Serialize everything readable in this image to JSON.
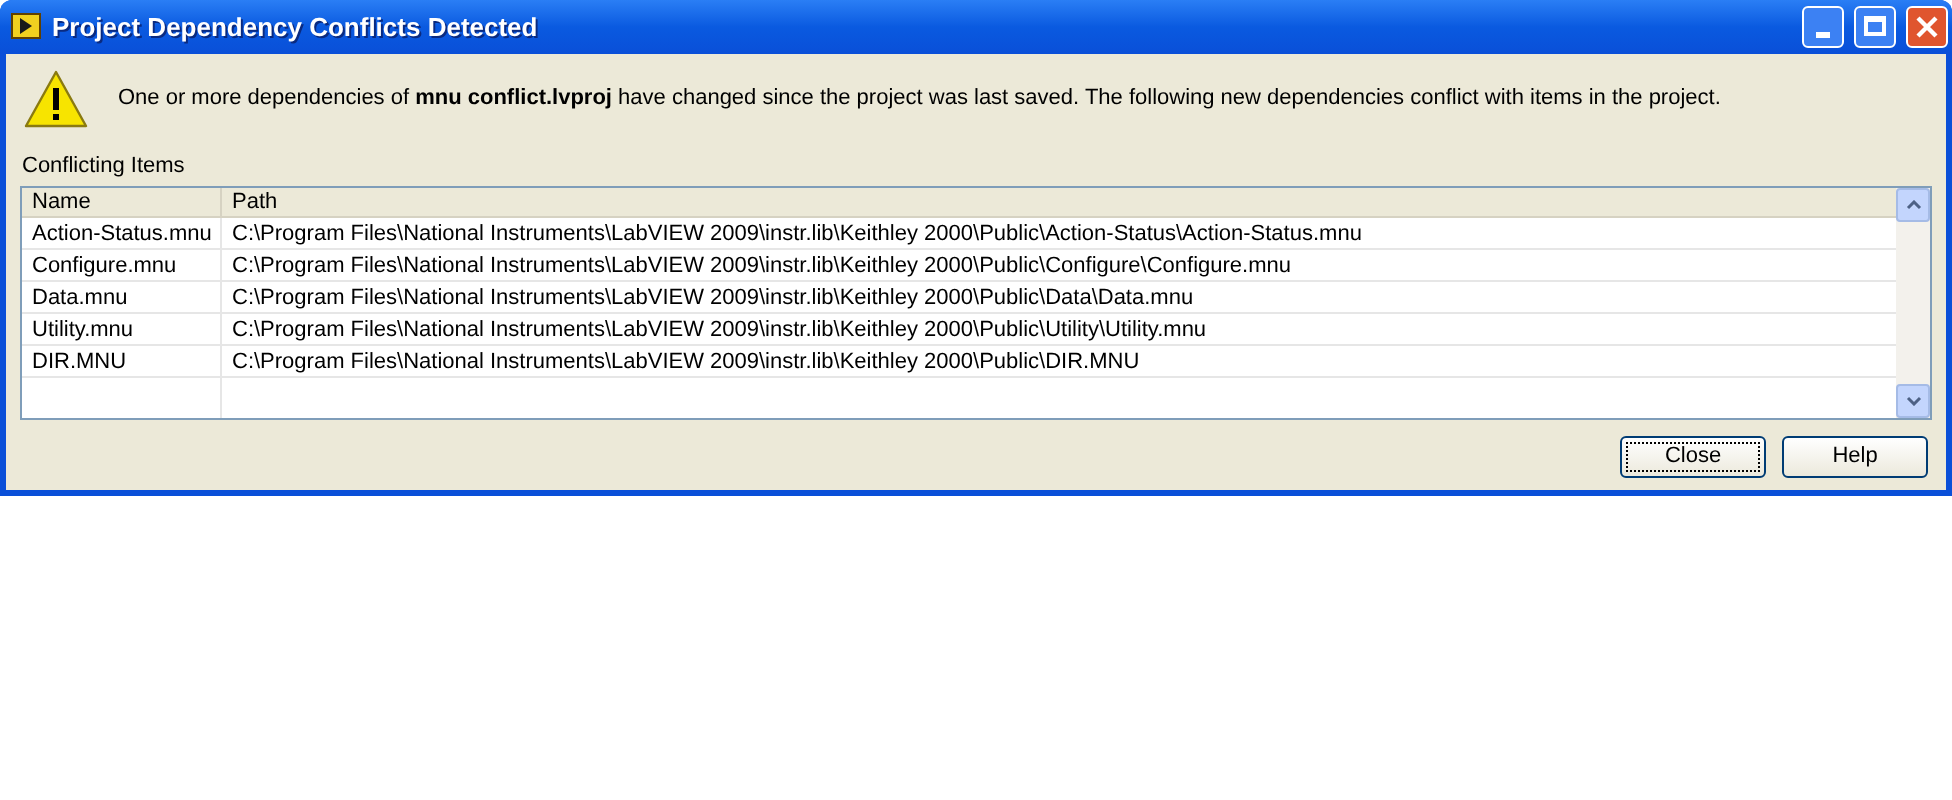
{
  "window": {
    "title": "Project Dependency Conflicts Detected"
  },
  "message": "One or more dependencies of **mnu conflict.lvproj** have changed since the project was last saved. The following new dependencies conflict with items in the project.",
  "list_label": "Conflicting Items",
  "table": {
    "columns": [
      "Name",
      "Path"
    ],
    "rows": [
      {
        "name": "Action-Status.mnu",
        "path": "C:\\Program Files\\National Instruments\\LabVIEW 2009\\instr.lib\\Keithley 2000\\Public\\Action-Status\\Action-Status.mnu"
      },
      {
        "name": "Configure.mnu",
        "path": "C:\\Program Files\\National Instruments\\LabVIEW 2009\\instr.lib\\Keithley 2000\\Public\\Configure\\Configure.mnu"
      },
      {
        "name": "Data.mnu",
        "path": "C:\\Program Files\\National Instruments\\LabVIEW 2009\\instr.lib\\Keithley 2000\\Public\\Data\\Data.mnu"
      },
      {
        "name": "Utility.mnu",
        "path": "C:\\Program Files\\National Instruments\\LabVIEW 2009\\instr.lib\\Keithley 2000\\Public\\Utility\\Utility.mnu"
      },
      {
        "name": "DIR.MNU",
        "path": "C:\\Program Files\\National Instruments\\LabVIEW 2009\\instr.lib\\Keithley 2000\\Public\\DIR.MNU"
      }
    ]
  },
  "buttons": [
    {
      "label": "Close",
      "focused": true
    },
    {
      "label": "Help",
      "focused": false
    }
  ]
}
